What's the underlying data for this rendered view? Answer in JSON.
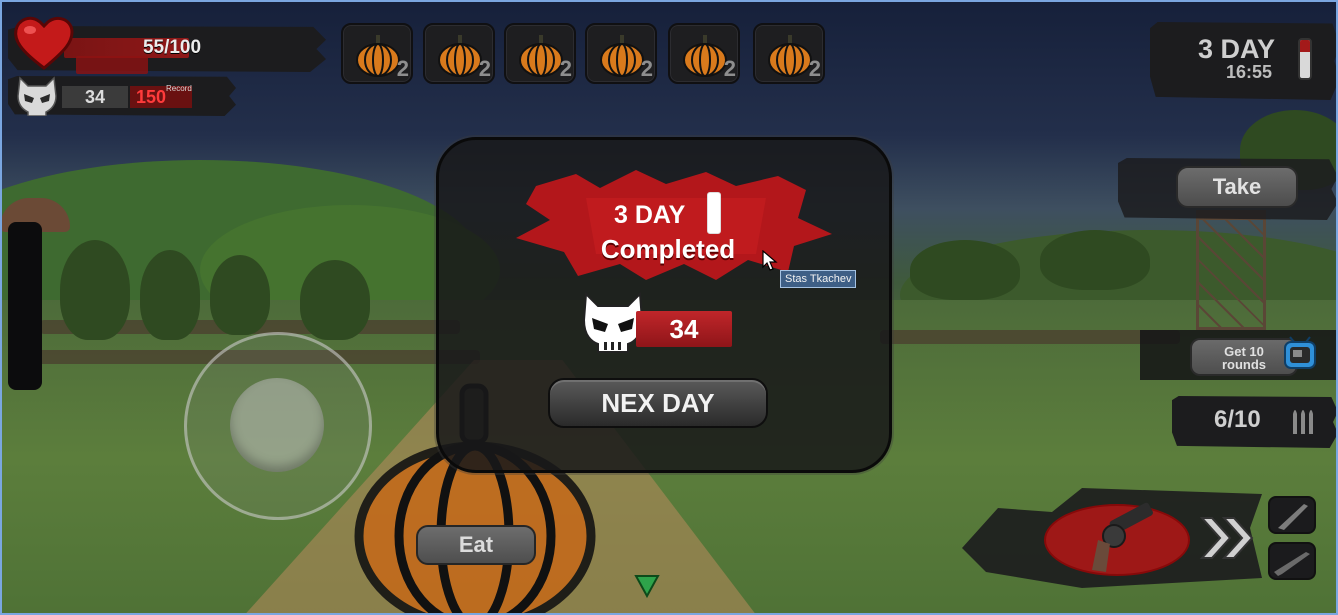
{
  "hud": {
    "health": {
      "text": "55/100",
      "value": 55,
      "max": 100
    },
    "kills": {
      "value": "34",
      "record_label": "Record",
      "record_value": "150"
    },
    "inventory": [
      {
        "item": "pumpkin-icon",
        "count": "2"
      },
      {
        "item": "pumpkin-icon",
        "count": "2"
      },
      {
        "item": "pumpkin-icon",
        "count": "2"
      },
      {
        "item": "pumpkin-icon",
        "count": "2"
      },
      {
        "item": "pumpkin-icon",
        "count": "2"
      },
      {
        "item": "pumpkin-icon",
        "count": "2"
      }
    ],
    "day": {
      "label": "3 DAY",
      "time": "16:55"
    },
    "take_label": "Take",
    "get_rounds_label": "Get 10 rounds",
    "ammo": "6/10",
    "eat_label": "Eat"
  },
  "modal": {
    "day_label": "3 DAY",
    "completed_label": "Completed",
    "score": "34",
    "next_label": "NEX DAY"
  },
  "tooltip": "Stas Tkachev",
  "colors": {
    "accent_red": "#b3171b",
    "panel_dark": "#1c1c1e",
    "button_gray": "#5a5a5a",
    "pumpkin_orange": "#d97a1c"
  }
}
